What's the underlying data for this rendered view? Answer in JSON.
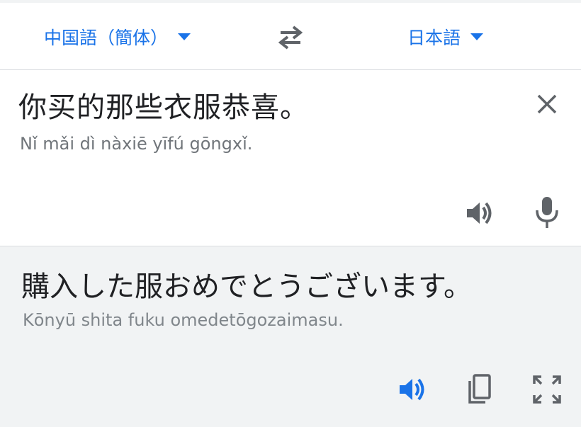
{
  "languages": {
    "source": "中国語（簡体）",
    "target": "日本語"
  },
  "source_panel": {
    "text": "你买的那些衣服恭喜。",
    "romanization": "Nǐ mǎi dì nàxiē yīfú gōngxǐ."
  },
  "target_panel": {
    "text": "購入した服おめでとうございます。",
    "romanization": "Kōnyū shita fuku omedetōgozaimasu."
  },
  "icons": {
    "caret": "caret-down-icon",
    "swap": "swap-icon",
    "clear": "close-icon",
    "speak": "speaker-icon",
    "mic": "microphone-icon",
    "copy": "copy-icon",
    "fullscreen": "fullscreen-icon"
  },
  "colors": {
    "accent": "#1a73e8",
    "icon_gray": "#5f6368",
    "text_primary": "#202124",
    "text_secondary": "#70757a",
    "target_background": "#f1f3f4"
  }
}
